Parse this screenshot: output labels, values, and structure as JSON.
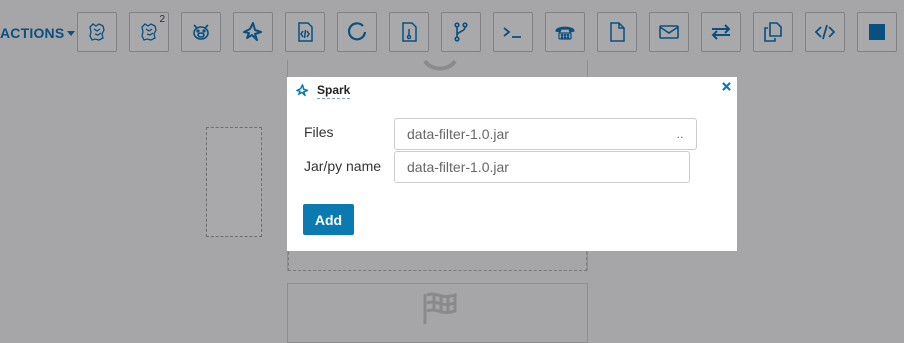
{
  "toolbar": {
    "actions_label": "ACTIONS",
    "buttons": [
      {
        "icon": "hive-icon"
      },
      {
        "icon": "hive2-icon",
        "badge": "2"
      },
      {
        "icon": "pig-icon"
      },
      {
        "icon": "spark-icon"
      },
      {
        "icon": "java-icon"
      },
      {
        "icon": "subworkflow-icon"
      },
      {
        "icon": "hdfs-icon"
      },
      {
        "icon": "git-branch-icon"
      },
      {
        "icon": "shell-icon"
      },
      {
        "icon": "ssh-phone-icon"
      },
      {
        "icon": "file-icon"
      },
      {
        "icon": "email-icon"
      },
      {
        "icon": "transfer-icon"
      },
      {
        "icon": "copy-icon"
      },
      {
        "icon": "code-icon"
      },
      {
        "icon": "stop-icon"
      }
    ]
  },
  "dialog": {
    "title": "Spark",
    "files_label": "Files",
    "files_value": "data-filter-1.0.jar",
    "browse_label": "..",
    "jar_label": "Jar/py name",
    "jar_value": "data-filter-1.0.jar",
    "add_label": "Add"
  },
  "colors": {
    "accent": "#0b7ab0",
    "icon": "#0b4f80",
    "overlay": "#a6a6a8"
  }
}
